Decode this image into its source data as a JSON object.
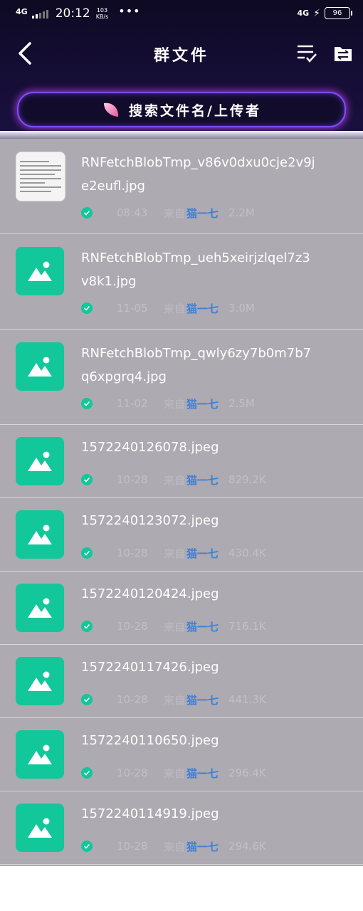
{
  "status_bar": {
    "network": "4G",
    "time": "20:12",
    "speed_value": "103",
    "speed_unit": "KB/s",
    "dots": "•••",
    "right_network": "4G",
    "battery": "96"
  },
  "header": {
    "title": "群文件",
    "search_placeholder": "搜索文件名/上传者"
  },
  "files": [
    {
      "name": "RNFetchBlobTmp_v86v0dxu0cje2v9je2eufl.jpg",
      "time": "08:43",
      "from": "来自",
      "uploader": "猫一七",
      "size": "2.2M",
      "thumb": "document"
    },
    {
      "name": "RNFetchBlobTmp_ueh5xeirjzlqel7z3v8k1.jpg",
      "time": "11-05",
      "from": "来自",
      "uploader": "猫一七",
      "size": "3.0M",
      "thumb": "image-icon"
    },
    {
      "name": "RNFetchBlobTmp_qwly6zy7b0m7b7q6xpgrq4.jpg",
      "time": "11-02",
      "from": "来自",
      "uploader": "猫一七",
      "size": "2.5M",
      "thumb": "image-icon"
    },
    {
      "name": "1572240126078.jpeg",
      "time": "10-28",
      "from": "来自",
      "uploader": "猫一七",
      "size": "829.2K",
      "thumb": "image-icon"
    },
    {
      "name": "1572240123072.jpeg",
      "time": "10-28",
      "from": "来自",
      "uploader": "猫一七",
      "size": "430.4K",
      "thumb": "image-icon"
    },
    {
      "name": "1572240120424.jpeg",
      "time": "10-28",
      "from": "来自",
      "uploader": "猫一七",
      "size": "716.1K",
      "thumb": "image-icon"
    },
    {
      "name": "1572240117426.jpeg",
      "time": "10-28",
      "from": "来自",
      "uploader": "猫一七",
      "size": "441.3K",
      "thumb": "image-icon"
    },
    {
      "name": "1572240110650.jpeg",
      "time": "10-28",
      "from": "来自",
      "uploader": "猫一七",
      "size": "296.4K",
      "thumb": "image-icon"
    },
    {
      "name": "1572240114919.jpeg",
      "time": "10-28",
      "from": "来自",
      "uploader": "猫一七",
      "size": "294.6K",
      "thumb": "image-icon"
    }
  ],
  "colors": {
    "header_bg": "#140d33",
    "list_bg": "#adaab1",
    "accent_green": "#12c79a",
    "uploader_blue": "#3d80d8",
    "search_border": "#7d4dff"
  }
}
